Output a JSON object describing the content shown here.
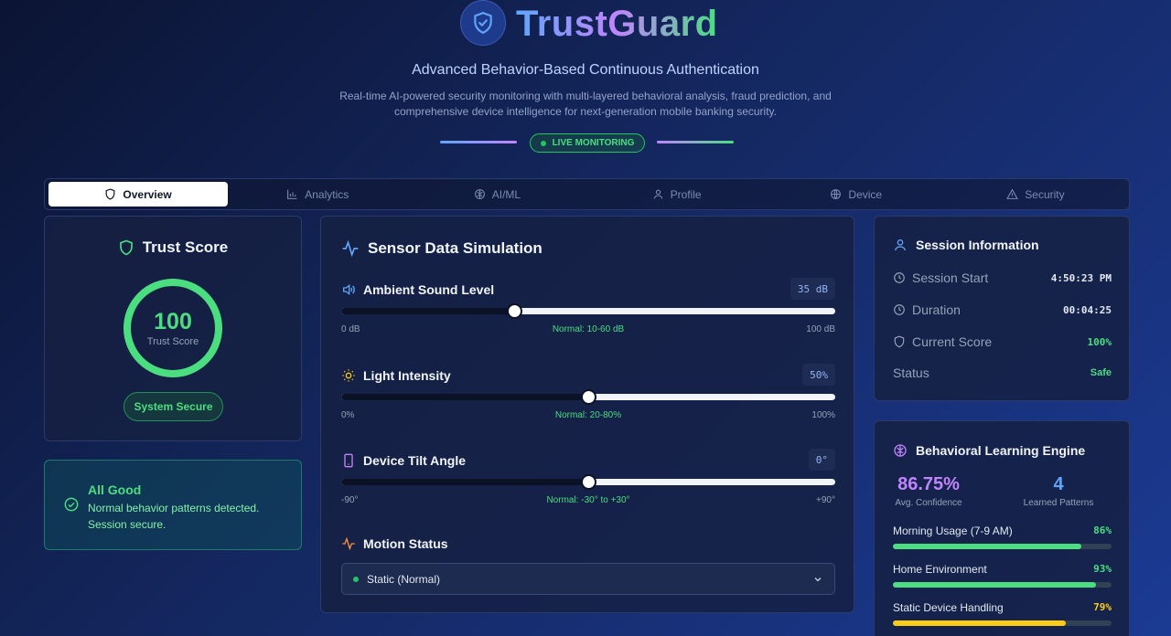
{
  "header": {
    "app_name": "TrustGuard",
    "subtitle": "Advanced Behavior-Based Continuous Authentication",
    "description": "Real-time AI-powered security monitoring with multi-layered behavioral analysis, fraud prediction, and comprehensive device intelligence for next-generation mobile banking security.",
    "live_badge": "LIVE MONITORING",
    "logo_icon": "shield-check-icon"
  },
  "tabs": [
    {
      "label": "Overview",
      "icon": "shield-icon",
      "active": true
    },
    {
      "label": "Analytics",
      "icon": "bar-chart-icon",
      "active": false
    },
    {
      "label": "AI/ML",
      "icon": "brain-icon",
      "active": false
    },
    {
      "label": "Profile",
      "icon": "user-icon",
      "active": false
    },
    {
      "label": "Device",
      "icon": "globe-icon",
      "active": false
    },
    {
      "label": "Security",
      "icon": "warning-icon",
      "active": false
    }
  ],
  "trust": {
    "title": "Trust Score",
    "score": "100",
    "score_fraction": 1.0,
    "score_label": "Trust Score",
    "status_pill": "System Secure"
  },
  "alert": {
    "title": "All Good",
    "line1": "Normal behavior patterns detected.",
    "line2": "Session secure."
  },
  "sensor": {
    "title": "Sensor Data Simulation",
    "sound": {
      "label": "Ambient Sound Level",
      "value": "35 dB",
      "level": 0.35,
      "min": "0 dB",
      "normal": "Normal: 10-60 dB",
      "max": "100 dB"
    },
    "light": {
      "label": "Light Intensity",
      "value": "50%",
      "level": 0.5,
      "min": "0%",
      "normal": "Normal: 20-80%",
      "max": "100%"
    },
    "tilt": {
      "label": "Device Tilt Angle",
      "value": "0°",
      "level": 0.5,
      "min": "-90°",
      "normal": "Normal: -30° to +30°",
      "max": "+90°"
    },
    "motion": {
      "label": "Motion Status",
      "selected": "Static (Normal)"
    }
  },
  "session": {
    "title": "Session Information",
    "start_label": "Session Start",
    "start_value": "4:50:23 PM",
    "duration_label": "Duration",
    "duration_value": "00:04:25",
    "score_label": "Current Score",
    "score_value": "100%",
    "status_label": "Status",
    "status_value": "Safe"
  },
  "behavior": {
    "title": "Behavioral Learning Engine",
    "confidence": "86.75%",
    "confidence_label": "Avg. Confidence",
    "patterns": "4",
    "patterns_label": "Learned Patterns",
    "items": [
      {
        "label": "Morning Usage (7-9 AM)",
        "value": "86%",
        "level": 0.86,
        "color": "#4ade80"
      },
      {
        "label": "Home Environment",
        "value": "93%",
        "level": 0.93,
        "color": "#4ade80"
      },
      {
        "label": "Static Device Handling",
        "value": "79%",
        "level": 0.79,
        "color": "#facc15"
      }
    ]
  },
  "colors": {
    "accent_green": "#4ade80",
    "accent_blue": "#60a5fa",
    "accent_purple": "#c084fc",
    "accent_yellow": "#facc15"
  }
}
